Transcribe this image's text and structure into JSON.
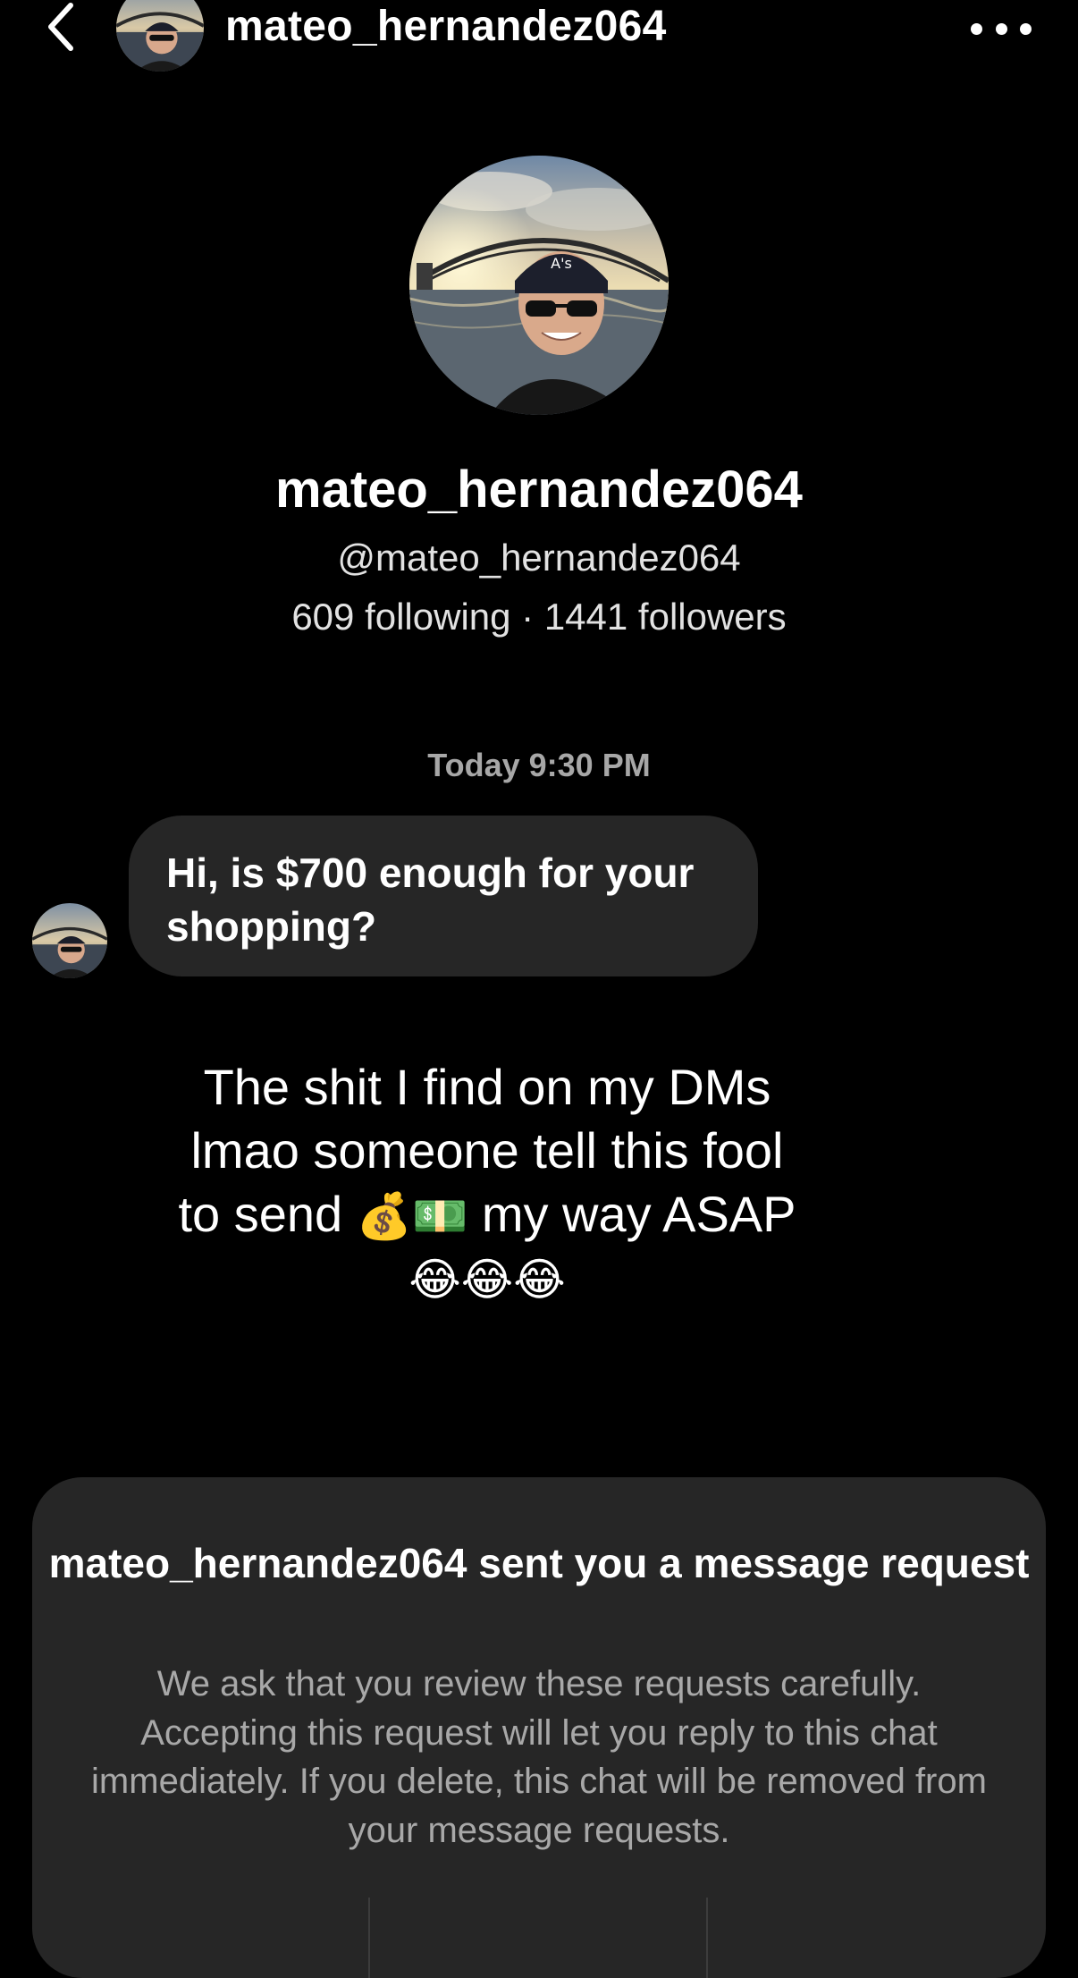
{
  "header": {
    "username": "mateo_hernandez064"
  },
  "profile": {
    "display_name": "mateo_hernandez064",
    "handle": "@mateo_hernandez064",
    "stats": "609 following · 1441 followers"
  },
  "thread": {
    "timestamp": "Today 9:30 PM",
    "message": "Hi, is $700 enough for your shopping?"
  },
  "caption": {
    "line1": "The shit I find on my DMs",
    "line2": "lmao someone tell this fool",
    "line3_before": "to send ",
    "line3_emoji": "💰💵",
    "line3_after": " my way ASAP",
    "line4_emoji": "😂😂😂"
  },
  "request": {
    "title": "mateo_hernandez064 sent you a message request",
    "description": "We ask that you review these requests carefully. Accepting this request will let you reply to this chat immediately. If you delete, this chat will be removed from your message requests."
  },
  "colors": {
    "background": "#000000",
    "bubble": "#262626",
    "card": "#262626",
    "secondary_text": "#a8a8a8"
  },
  "icons": {
    "back": "chevron-left-icon",
    "more": "more-horizontal-icon"
  }
}
